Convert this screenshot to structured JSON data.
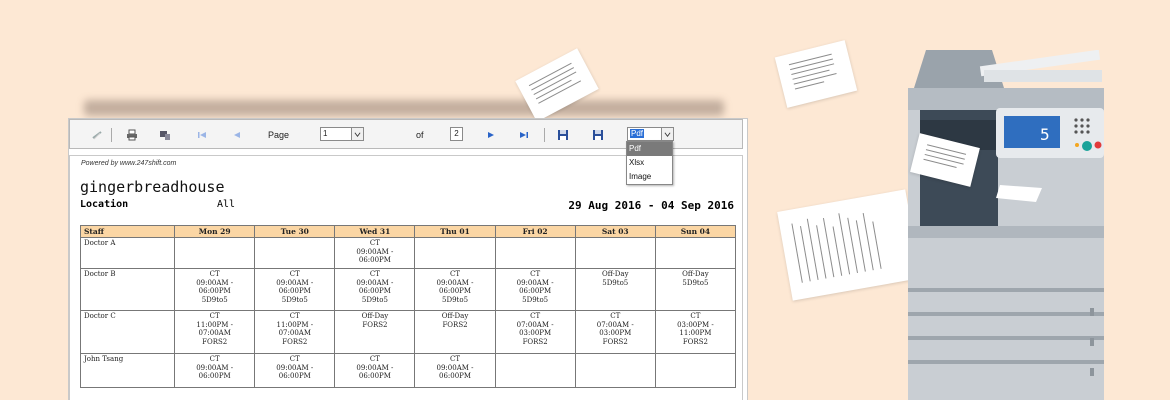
{
  "toolbar": {
    "page_label": "Page",
    "current_page": "1",
    "of_label": "of",
    "total_pages": "2",
    "format_selected": "Pdf"
  },
  "format_menu": {
    "options": [
      "Pdf",
      "Xlsx",
      "Image"
    ]
  },
  "report": {
    "powered_by": "Powered by www.247shift.com",
    "organization": "gingerbreadhouse",
    "location_label": "Location",
    "location_value": "All",
    "date_range": "29 Aug 2016 - 04 Sep 2016"
  },
  "schedule": {
    "headers": [
      "Staff",
      "Mon 29",
      "Tue 30",
      "Wed 31",
      "Thu 01",
      "Fri 02",
      "Sat 03",
      "Sun 04"
    ],
    "rows": [
      {
        "staff": "Doctor A",
        "cells": [
          [],
          [],
          [
            "CT",
            "09:00AM -",
            "06:00PM"
          ],
          [],
          [],
          [],
          []
        ]
      },
      {
        "staff": "Doctor B",
        "cells": [
          [
            "CT",
            "09:00AM -",
            "06:00PM",
            "5D9to5"
          ],
          [
            "CT",
            "09:00AM -",
            "06:00PM",
            "5D9to5"
          ],
          [
            "CT",
            "09:00AM -",
            "06:00PM",
            "5D9to5"
          ],
          [
            "CT",
            "09:00AM -",
            "06:00PM",
            "5D9to5"
          ],
          [
            "CT",
            "09:00AM -",
            "06:00PM",
            "5D9to5"
          ],
          [
            "Off-Day",
            "5D9to5"
          ],
          [
            "Off-Day",
            "5D9to5"
          ]
        ]
      },
      {
        "staff": "Doctor C",
        "cells": [
          [
            "CT",
            "11:00PM -",
            "07:00AM",
            "FORS2"
          ],
          [
            "CT",
            "11:00PM -",
            "07:00AM",
            "FORS2"
          ],
          [
            "Off-Day",
            "FORS2"
          ],
          [
            "Off-Day",
            "FORS2"
          ],
          [
            "CT",
            "07:00AM -",
            "03:00PM",
            "FORS2"
          ],
          [
            "CT",
            "07:00AM -",
            "03:00PM",
            "FORS2"
          ],
          [
            "CT",
            "03:00PM -",
            "11:00PM",
            "FORS2"
          ]
        ]
      },
      {
        "staff": "John Tsang",
        "cells": [
          [
            "CT",
            "09:00AM -",
            "06:00PM"
          ],
          [
            "CT",
            "09:00AM -",
            "06:00PM"
          ],
          [
            "CT",
            "09:00AM -",
            "06:00PM"
          ],
          [
            "CT",
            "09:00AM -",
            "06:00PM"
          ],
          [],
          [],
          []
        ]
      }
    ]
  },
  "colors": {
    "background": "#fde8d4",
    "header_fill": "#fbd6a4",
    "copier_body": "#c9ced3",
    "copier_panel": "#2f6ebf",
    "toolbar_icon_blue": "#2a64c8"
  },
  "icons": {
    "toolbar": [
      "refresh-icon",
      "print-icon",
      "print-setup-icon",
      "first-page-icon",
      "prev-page-icon",
      "next-page-icon",
      "last-page-icon",
      "save-icon",
      "export-icon"
    ]
  }
}
